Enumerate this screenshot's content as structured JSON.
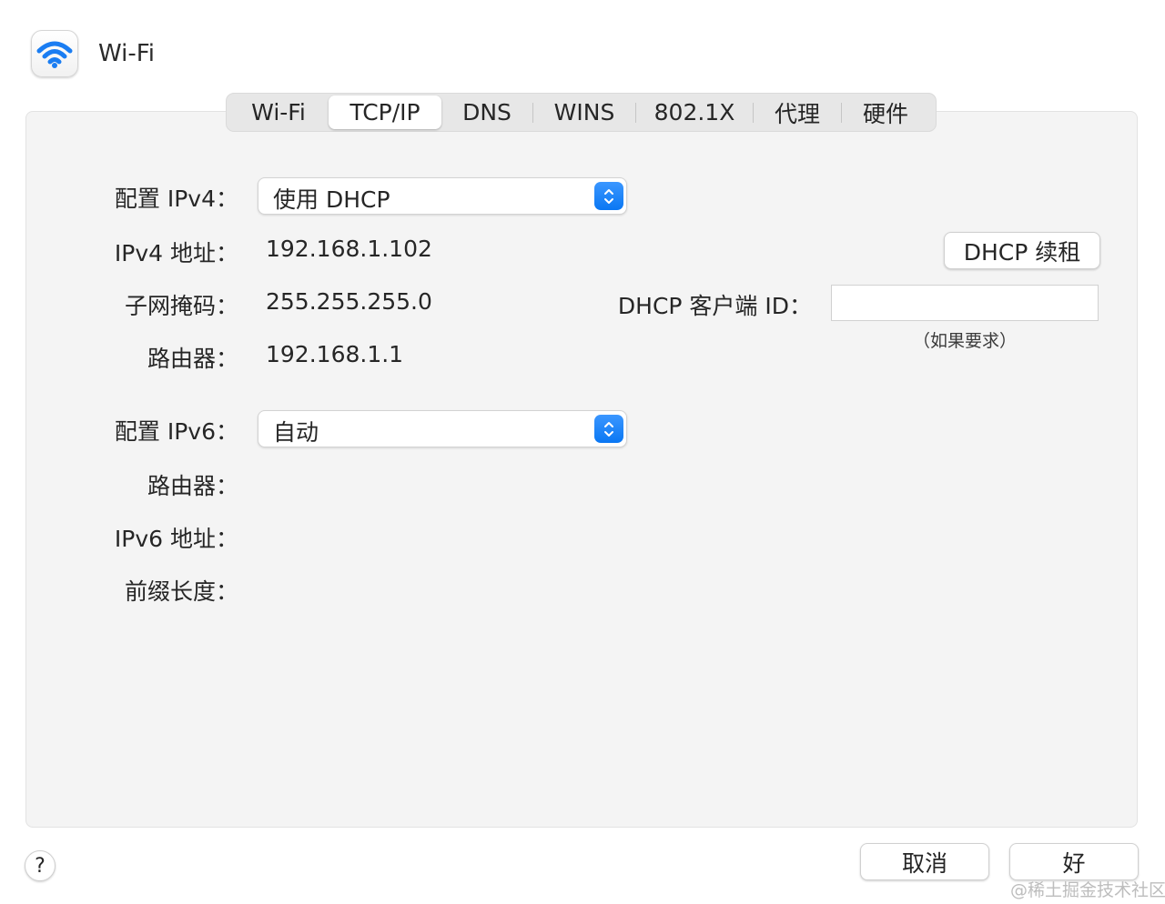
{
  "window": {
    "title": "Wi-Fi",
    "icon": "wifi-icon"
  },
  "tabs": [
    {
      "label": "Wi-Fi",
      "selected": false
    },
    {
      "label": "TCP/IP",
      "selected": true
    },
    {
      "label": "DNS",
      "selected": false
    },
    {
      "label": "WINS",
      "selected": false
    },
    {
      "label": "802.1X",
      "selected": false
    },
    {
      "label": "代理",
      "selected": false
    },
    {
      "label": "硬件",
      "selected": false
    }
  ],
  "ipv4": {
    "configure_label": "配置 IPv4：",
    "configure_value": "使用 DHCP",
    "address_label": "IPv4 地址：",
    "address_value": "192.168.1.102",
    "subnet_label": "子网掩码：",
    "subnet_value": "255.255.255.0",
    "router_label": "路由器：",
    "router_value": "192.168.1.1"
  },
  "dhcp": {
    "renew_label": "DHCP 续租",
    "client_id_label": "DHCP 客户端 ID：",
    "client_id_value": "",
    "client_id_hint": "（如果要求）"
  },
  "ipv6": {
    "configure_label": "配置 IPv6：",
    "configure_value": "自动",
    "router_label": "路由器：",
    "address_label": "IPv6 地址：",
    "prefix_label": "前缀长度："
  },
  "footer": {
    "help_label": "?",
    "cancel_label": "取消",
    "ok_label": "好"
  },
  "watermark": "@稀土掘金技术社区",
  "colors": {
    "accent": "#0a77f3",
    "panel_bg": "#f4f4f4",
    "wifi_icon": "#1a7df2"
  }
}
